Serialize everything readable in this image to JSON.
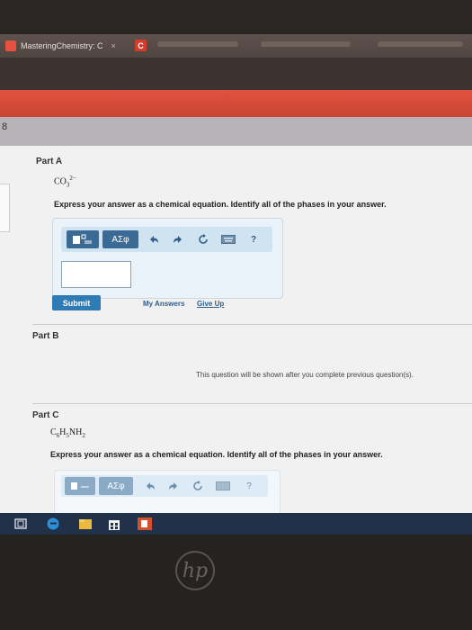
{
  "browser": {
    "tab_title": "MasteringChemistry: C",
    "tab_close": "×",
    "second_tab_icon": "C"
  },
  "page_number": "8",
  "partA": {
    "title": "Part A",
    "formula": {
      "base": "CO",
      "sub": "3",
      "sup": "2−"
    },
    "prompt": "Express your answer as a chemical equation. Identify all of the phases in your answer.",
    "toolbar": {
      "template_icon": "template-icon",
      "greek_label": "ΑΣφ",
      "undo_icon": "undo-icon",
      "redo_icon": "redo-icon",
      "reset_icon": "reset-icon",
      "keyboard_icon": "keyboard-icon",
      "help_label": "?"
    },
    "input_value": "",
    "submit_label": "Submit",
    "my_answers_label": "My Answers",
    "give_up_label": "Give Up"
  },
  "partB": {
    "title": "Part B",
    "notice": "This question will be shown after you complete previous question(s)."
  },
  "partC": {
    "title": "Part C",
    "formula": {
      "a": "C",
      "a_sub": "6",
      "b": "H",
      "b_sub": "5",
      "c": "NH",
      "c_sub": "2"
    },
    "prompt": "Express your answer as a chemical equation. Identify all of the phases in your answer.",
    "toolbar": {
      "greek_label": "ΑΣφ",
      "help_label": "?"
    }
  },
  "taskbar": {
    "items": [
      "task-view-icon",
      "edge-browser-icon",
      "file-explorer-icon",
      "store-icon",
      "powerpoint-icon"
    ]
  },
  "laptop_brand": "hp",
  "colors": {
    "accent_red": "#e0533e",
    "submit_blue": "#2e7bb5",
    "toolbar_blue": "#cfe3f1",
    "taskbar": "#22314a"
  }
}
